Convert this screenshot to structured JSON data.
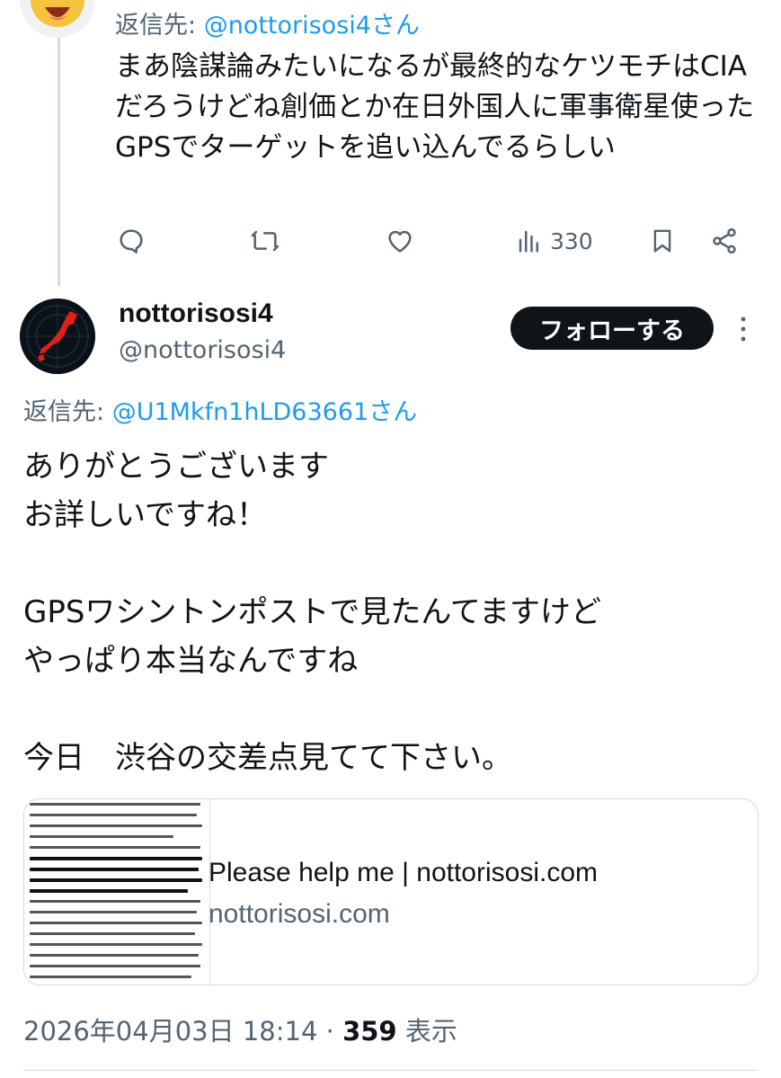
{
  "reply": {
    "replying_to_label": "返信先: ",
    "replying_to_mention": "@nottorisosi4さん",
    "text": "まあ陰謀論みたいになるが最終的なケツモチはCIAだろうけどね創価とか在日外国人に軍事衛星使ったGPSでターゲットを追い込んでるらしい",
    "views": "330",
    "icons": {
      "avatar": "emoji-face-avatar",
      "reply": "comment-icon",
      "repost": "repost-icon",
      "like": "heart-icon",
      "views": "bar-chart-icon",
      "bookmark": "bookmark-icon",
      "share": "share-icon"
    }
  },
  "tweet": {
    "display_name": "nottorisosi4",
    "handle": "@nottorisosi4",
    "follow_label": "フォローする",
    "replying_to_label": "返信先: ",
    "replying_to_mention": "@U1Mkfn1hLD63661さん",
    "lines": [
      "ありがとうございます",
      "お詳しいですね！",
      "",
      "GPSワシントンポストで見たんてますけど",
      "やっぱり本当なんですね",
      "",
      "今日　渋谷の交差点見てて下さい。"
    ],
    "card": {
      "title": "Please help me | nottorisosi.com",
      "domain": "nottorisosi.com"
    },
    "timestamp": "2026年04月03日 18:14",
    "separator": " · ",
    "views_count": "359",
    "views_label": " 表示",
    "icons": {
      "avatar": "japan-map-avatar",
      "more": "more-vertical-icon"
    }
  },
  "colors": {
    "text_primary": "#0f1419",
    "text_secondary": "#536471",
    "link": "#1d9bf0",
    "border": "#cfd9de",
    "avatar_red": "#e0201a",
    "emoji_yellow": "#f7c23c"
  }
}
